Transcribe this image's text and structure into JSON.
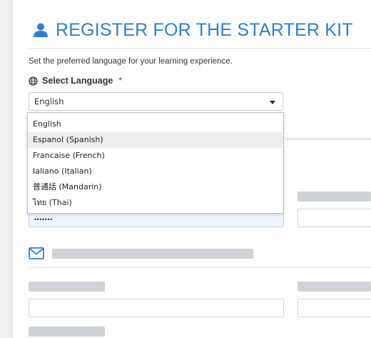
{
  "header": {
    "title": "REGISTER FOR THE STARTER KIT",
    "icon": "user-icon"
  },
  "language": {
    "description": "Set the preferred language for your learning experience.",
    "label": "Select Language",
    "required_marker": "*",
    "selected": "English",
    "options": [
      "English",
      "Espanol (Spanish)",
      "Francaise (French)",
      "Ialiano (Italian)",
      "普通話 (Mandarin)",
      "ไทย (Thai)"
    ],
    "highlighted_index": 1
  },
  "password_field": {
    "masked_value": "•••••••"
  },
  "colors": {
    "accent": "#2f7fd0",
    "placeholder_block": "#cfd2d6",
    "password_bg": "#eef4fd"
  }
}
